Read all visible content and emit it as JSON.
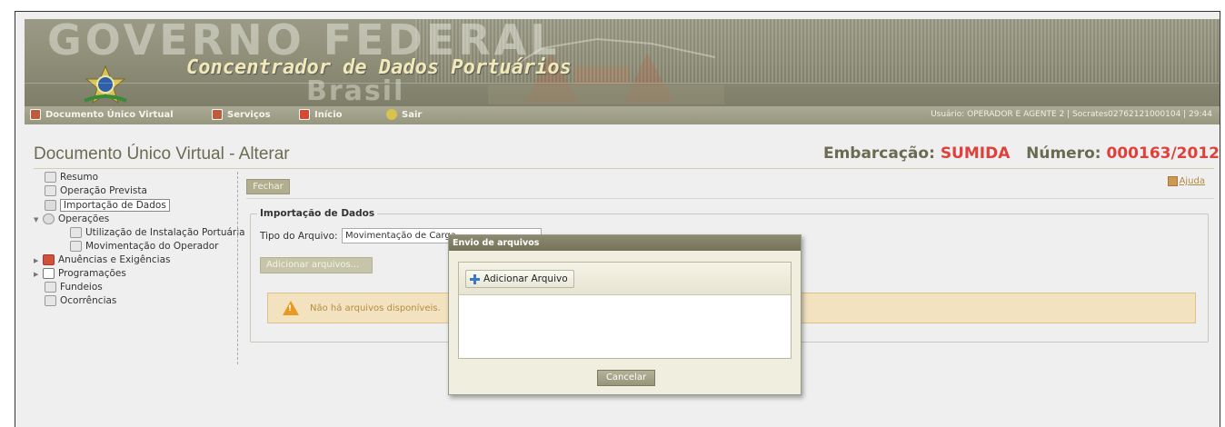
{
  "banner": {
    "gov_title": "GOVERNO FEDERAL",
    "portal_title": "Concentrador de Dados Portuários",
    "country": "Brasil"
  },
  "menu": {
    "items": [
      {
        "label": "Documento Único Virtual",
        "icon": "document-icon"
      },
      {
        "label": "Serviços",
        "icon": "services-icon"
      },
      {
        "label": "Início",
        "icon": "home-icon"
      },
      {
        "label": "Sair",
        "icon": "exit-icon"
      }
    ],
    "user_info": "Usuário: OPERADOR E AGENTE 2    | Socrates02762121000104 |    29:44"
  },
  "header": {
    "page_title": "Documento Único Virtual - Alterar",
    "vessel_label": "Embarcação:",
    "vessel_name": "SUMIDA",
    "number_label": "Número:",
    "number_value": "000163/2012"
  },
  "tree": {
    "items": [
      {
        "label": "Resumo"
      },
      {
        "label": "Operação Prevista"
      },
      {
        "label": "Importação de Dados"
      },
      {
        "label": "Operações"
      },
      {
        "label": "Utilização de Instalação Portuária"
      },
      {
        "label": "Movimentação do Operador"
      },
      {
        "label": "Anuências e Exigências"
      },
      {
        "label": "Programações"
      },
      {
        "label": "Fundeios"
      },
      {
        "label": "Ocorrências"
      }
    ]
  },
  "main": {
    "close_label": "Fechar",
    "help_label": "Ajuda",
    "fieldset_legend": "Importação de Dados",
    "tipo_label": "Tipo do Arquivo:",
    "tipo_value": "Movimentação de Carga",
    "add_files_label": "Adicionar arquivos...",
    "warning_text": "Não há arquivos disponíveis."
  },
  "modal": {
    "title": "Envio de arquivos",
    "add_file_label": "Adicionar Arquivo",
    "cancel_label": "Cancelar"
  },
  "colors": {
    "banner": "#8c8c76",
    "menubar": "#a0a08a",
    "title_text": "#6b6b52",
    "highlight_red": "#e0403a",
    "warning_bg": "#f2e2c0"
  }
}
